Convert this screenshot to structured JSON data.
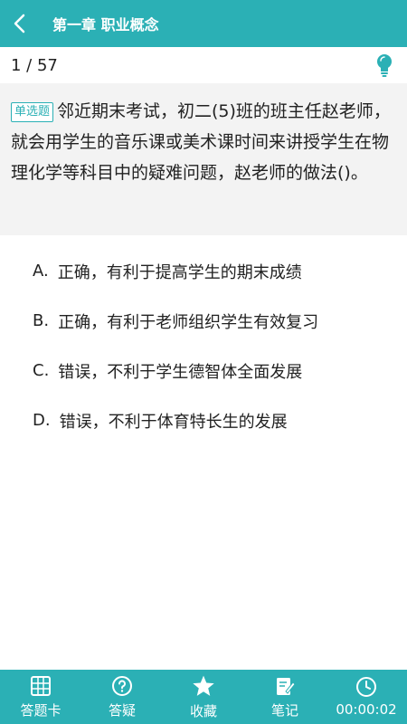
{
  "header": {
    "title": "第一章 职业概念",
    "back_icon": "chevron-left-icon"
  },
  "progress": {
    "text": "1 / 57",
    "hint_icon": "lightbulb-icon"
  },
  "question": {
    "type_badge": "单选题",
    "text": "邻近期末考试，初二(5)班的班主任赵老师，就会用学生的音乐课或美术课时间来讲授学生在物理化学等科目中的疑难问题，赵老师的做法()。"
  },
  "options": [
    {
      "letter": "A.",
      "text": "正确，有利于提高学生的期末成绩"
    },
    {
      "letter": "B.",
      "text": "正确，有利于老师组织学生有效复习"
    },
    {
      "letter": "C.",
      "text": "错误，不利于学生德智体全面发展"
    },
    {
      "letter": "D.",
      "text": "错误，不利于体育特长生的发展"
    }
  ],
  "bottom_bar": {
    "answer_card": "答题卡",
    "question_help": "答疑",
    "favorite": "收藏",
    "notes": "笔记",
    "timer": "00:00:02"
  },
  "colors": {
    "accent": "#2bb0b5",
    "question_bg": "#f3f3f3",
    "hint_icon": "#2bb0b5"
  }
}
